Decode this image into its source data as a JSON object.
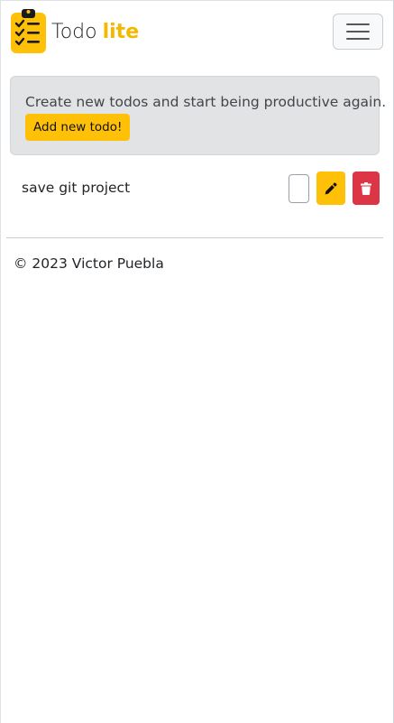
{
  "navbar": {
    "brand_text": "Todo",
    "brand_accent": "lite",
    "logo_icon": "clipboard-checklist-icon",
    "menu_icon": "hamburger-menu-icon"
  },
  "alert": {
    "message": "Create new todos and start being productive again.",
    "add_button_label": "Add new todo!"
  },
  "todos": [
    {
      "title": "save git project",
      "completed": false
    }
  ],
  "footer": {
    "copyright": "© 2023 Victor Puebla"
  },
  "colors": {
    "accent": "#ffc107",
    "danger": "#dc3545",
    "alert_bg": "#e2e3e5"
  }
}
